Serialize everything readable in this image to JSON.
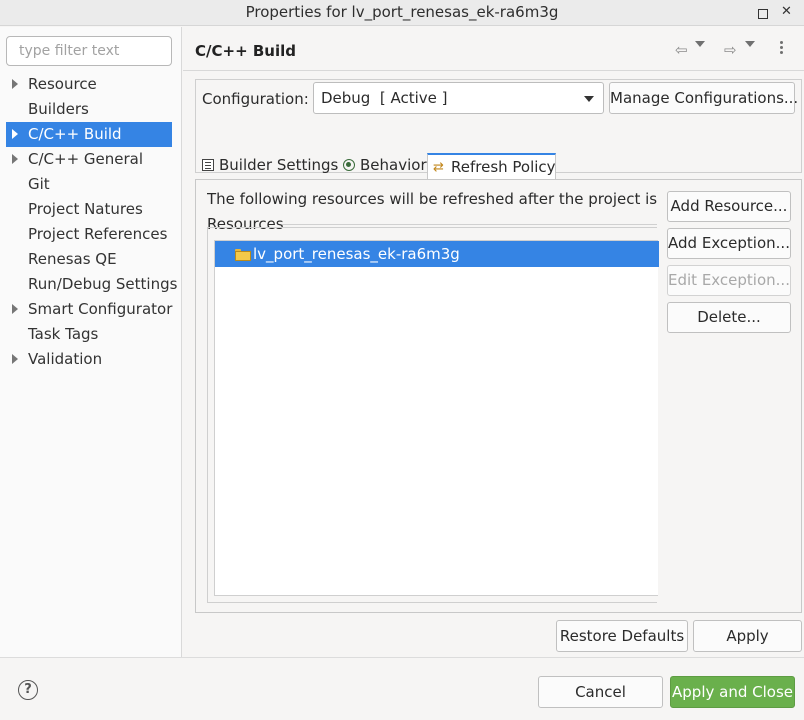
{
  "window": {
    "title": "Properties for lv_port_renesas_ek-ra6m3g"
  },
  "filter": {
    "placeholder": "type filter text"
  },
  "tree": {
    "items": [
      {
        "label": "Resource",
        "expandable": true
      },
      {
        "label": "Builders",
        "expandable": false
      },
      {
        "label": "C/C++ Build",
        "expandable": true,
        "selected": true
      },
      {
        "label": "C/C++ General",
        "expandable": true
      },
      {
        "label": "Git",
        "expandable": false
      },
      {
        "label": "Project Natures",
        "expandable": false
      },
      {
        "label": "Project References",
        "expandable": false
      },
      {
        "label": "Renesas QE",
        "expandable": false
      },
      {
        "label": "Run/Debug Settings",
        "expandable": false
      },
      {
        "label": "Smart Configurator",
        "expandable": true
      },
      {
        "label": "Task Tags",
        "expandable": false
      },
      {
        "label": "Validation",
        "expandable": true
      }
    ]
  },
  "page": {
    "heading": "C/C++ Build",
    "nav_icons": [
      "back-arrow-icon",
      "back-menu-icon",
      "forward-arrow-icon",
      "forward-menu-icon",
      "view-menu-icon"
    ]
  },
  "configuration": {
    "label": "Configuration:",
    "value": "Debug  [ Active ]",
    "manage_label": "Manage Configurations..."
  },
  "tabs": [
    {
      "label": "Builder Settings",
      "icon": "builder-settings-icon",
      "active": false
    },
    {
      "label": "Behavior",
      "icon": "behavior-icon",
      "active": false
    },
    {
      "label": "Refresh Policy",
      "icon": "refresh-policy-icon",
      "active": true
    }
  ],
  "refresh": {
    "description": "The following resources will be refreshed after the project is bu",
    "resources_label": "Resources",
    "resources": [
      {
        "label": "lv_port_renesas_ek-ra6m3g",
        "icon": "folder-icon",
        "selected": true
      }
    ],
    "add_resource": "Add Resource...",
    "add_exception": "Add Exception...",
    "edit_exception": "Edit Exception...",
    "delete": "Delete..."
  },
  "actions": {
    "restore_defaults": "Restore Defaults",
    "apply": "Apply"
  },
  "footer": {
    "help_icon": "help-icon",
    "cancel": "Cancel",
    "apply_and_close": "Apply and Close"
  },
  "colors": {
    "selection": "#3584e4",
    "primary_button": "#6ab04c",
    "tab_accent": "#3584e4"
  }
}
